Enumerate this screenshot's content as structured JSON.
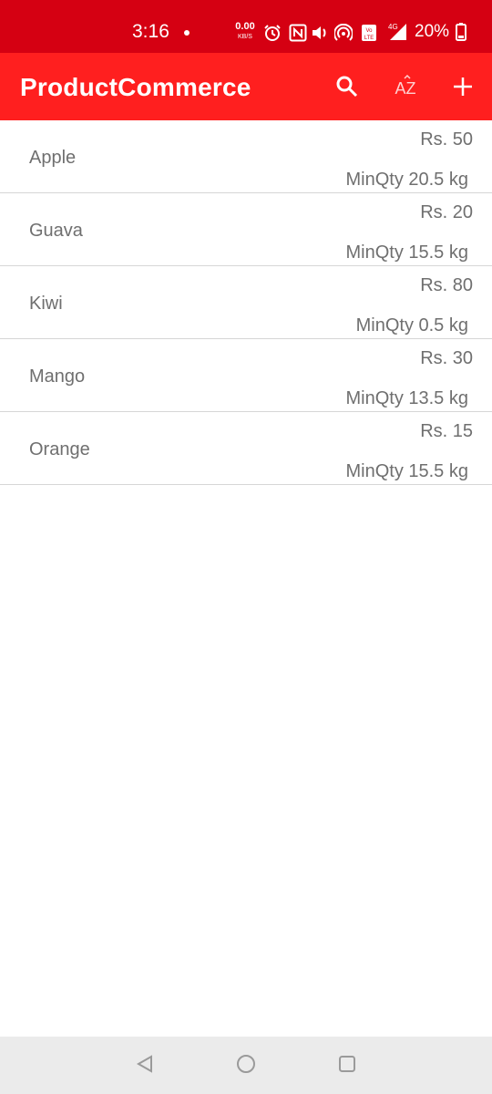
{
  "status_bar": {
    "time": "3:16",
    "net_speed_value": "0.00",
    "net_speed_unit": "KB/S",
    "battery": "20%",
    "icons": [
      "alarm-icon",
      "nfc-icon",
      "volume-icon",
      "hotspot-icon",
      "volte-icon",
      "signal-4g-icon",
      "battery-icon"
    ],
    "volte_label": "VoLTE",
    "network_label": "4G"
  },
  "app_bar": {
    "title": "ProductCommerce",
    "background": "#ff1f1f",
    "actions": [
      {
        "icon": "search-icon"
      },
      {
        "icon": "sort-az-icon",
        "label": "AZ"
      },
      {
        "icon": "add-icon"
      }
    ]
  },
  "products": [
    {
      "name": "Apple",
      "price": "Rs. 50",
      "min_qty": "MinQty 20.5 kg"
    },
    {
      "name": "Guava",
      "price": "Rs. 20",
      "min_qty": "MinQty 15.5 kg"
    },
    {
      "name": "Kiwi",
      "price": "Rs. 80",
      "min_qty": "MinQty 0.5 kg"
    },
    {
      "name": "Mango",
      "price": "Rs. 30",
      "min_qty": "MinQty 13.5 kg"
    },
    {
      "name": "Orange",
      "price": "Rs. 15",
      "min_qty": "MinQty 15.5 kg"
    }
  ],
  "nav_bar": {
    "buttons": [
      "back-icon",
      "home-icon",
      "recents-icon"
    ]
  }
}
